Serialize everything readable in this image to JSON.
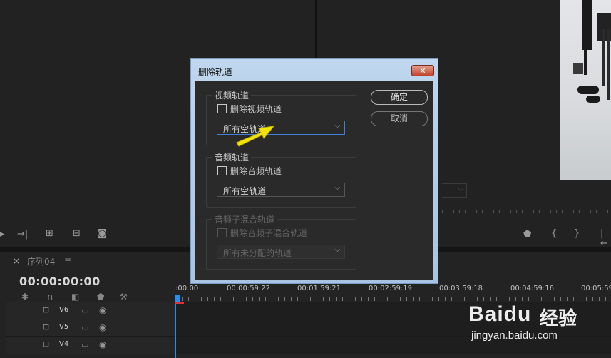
{
  "dialog": {
    "title": "删除轨道",
    "close_label": "✕",
    "video_group": {
      "title": "视频轨道",
      "checkbox_label": "删除视频轨道",
      "dropdown_value": "所有空轨道"
    },
    "audio_group": {
      "title": "音频轨道",
      "checkbox_label": "删除音频轨道",
      "dropdown_value": "所有空轨道"
    },
    "submix_group": {
      "title": "音频子混合轨道",
      "checkbox_label": "删除音频子混合轨道",
      "dropdown_value": "所有未分配的轨道"
    },
    "ok_label": "确定",
    "cancel_label": "取消"
  },
  "timeline": {
    "tab_close": "×",
    "sequence_label": "序列04",
    "menu_label": "≡",
    "timecode": "00:00:00:00",
    "ruler_labels": [
      ":00:00",
      "00:00:59:22",
      "00:01:59:21",
      "00:02:59:19",
      "00:03:59:18",
      "00:04:59:16",
      "00:05:59"
    ],
    "tracks": [
      "V6",
      "V5",
      "V4"
    ]
  },
  "watermark": {
    "logo": "Baidu",
    "text": "经验",
    "url": "jingyan.baidu.com"
  },
  "colors": {
    "accent": "#2d8ceb",
    "arrow": "#f5e400",
    "dialog_frame": "#a8c4e2"
  }
}
